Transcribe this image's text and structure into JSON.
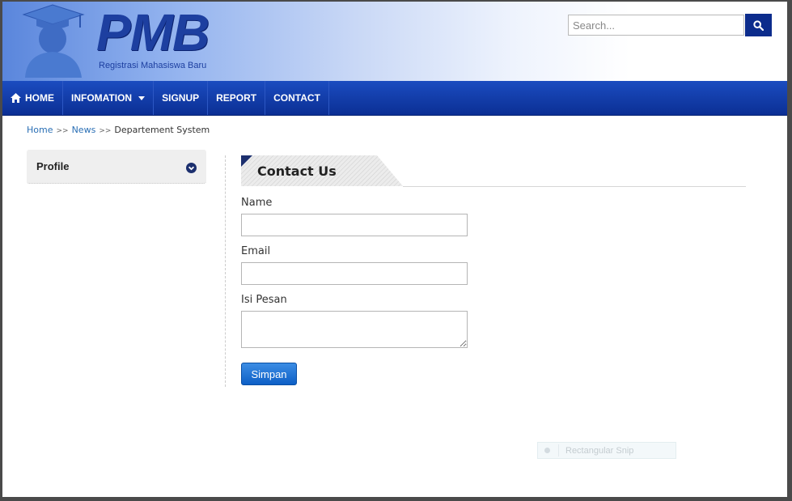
{
  "header": {
    "logo_title": "PMB",
    "logo_subtitle": "Registrasi Mahasiswa Baru",
    "search_placeholder": "Search...",
    "search_icon": "search-icon"
  },
  "nav": {
    "items": [
      {
        "label": "HOME",
        "icon": "home-icon"
      },
      {
        "label": "INFOMATION",
        "has_dropdown": true
      },
      {
        "label": "SIGNUP"
      },
      {
        "label": "REPORT"
      },
      {
        "label": "CONTACT"
      }
    ]
  },
  "breadcrumb": {
    "items": [
      "Home",
      "News",
      "Departement System"
    ],
    "separator": ">>"
  },
  "sidebar": {
    "title": "Profile",
    "toggle_icon": "chevron-down-circle-icon"
  },
  "main": {
    "section_title": "Contact Us",
    "form": {
      "name_label": "Name",
      "name_value": "",
      "email_label": "Email",
      "email_value": "",
      "message_label": "Isi Pesan",
      "message_value": "",
      "submit_label": "Simpan"
    }
  },
  "overlay": {
    "snip_label": "Rectangular Snip"
  },
  "colors": {
    "nav_bg": "#0b2f94",
    "logo_blue": "#1d3fa0",
    "link": "#2a6fb5",
    "button": "#0d5fc6"
  }
}
